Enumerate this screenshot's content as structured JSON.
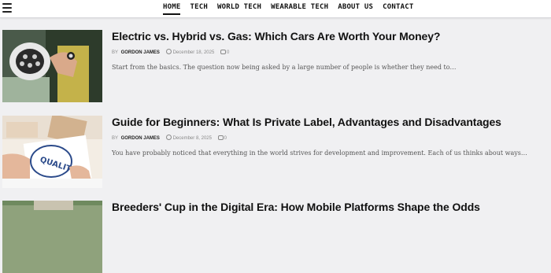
{
  "nav": {
    "items": [
      {
        "label": "HOME",
        "active": true
      },
      {
        "label": "TECH"
      },
      {
        "label": "WORLD TECH"
      },
      {
        "label": "WEARABLE TECH"
      },
      {
        "label": "ABOUT US"
      },
      {
        "label": "CONTACT"
      }
    ]
  },
  "posts": [
    {
      "title": "Electric vs. Hybrid vs. Gas: Which Cars Are Worth Your Money?",
      "by": "BY",
      "author": "GORDON JAMES",
      "date": "December 18, 2025",
      "comments": "0",
      "excerpt": "Start from the basics. The question now being asked by a large number of people is whether they need to…"
    },
    {
      "title": "Guide for Beginners: What Is Private Label, Advantages and Disadvantages",
      "by": "BY",
      "author": "GORDON JAMES",
      "date": "December 8, 2025",
      "comments": "0",
      "excerpt": "You have probably noticed that everything in the world strives for development and improvement. Each of us thinks about ways…",
      "image_text": "QUALITY"
    },
    {
      "title": "Breeders' Cup in the Digital Era: How Mobile Platforms Shape the Odds"
    }
  ],
  "colors": {
    "accent": "#111111",
    "background": "#f0f0f2",
    "meta": "#8a8a8a"
  },
  "icons": [
    "menu-icon",
    "clock-icon",
    "comment-icon"
  ]
}
